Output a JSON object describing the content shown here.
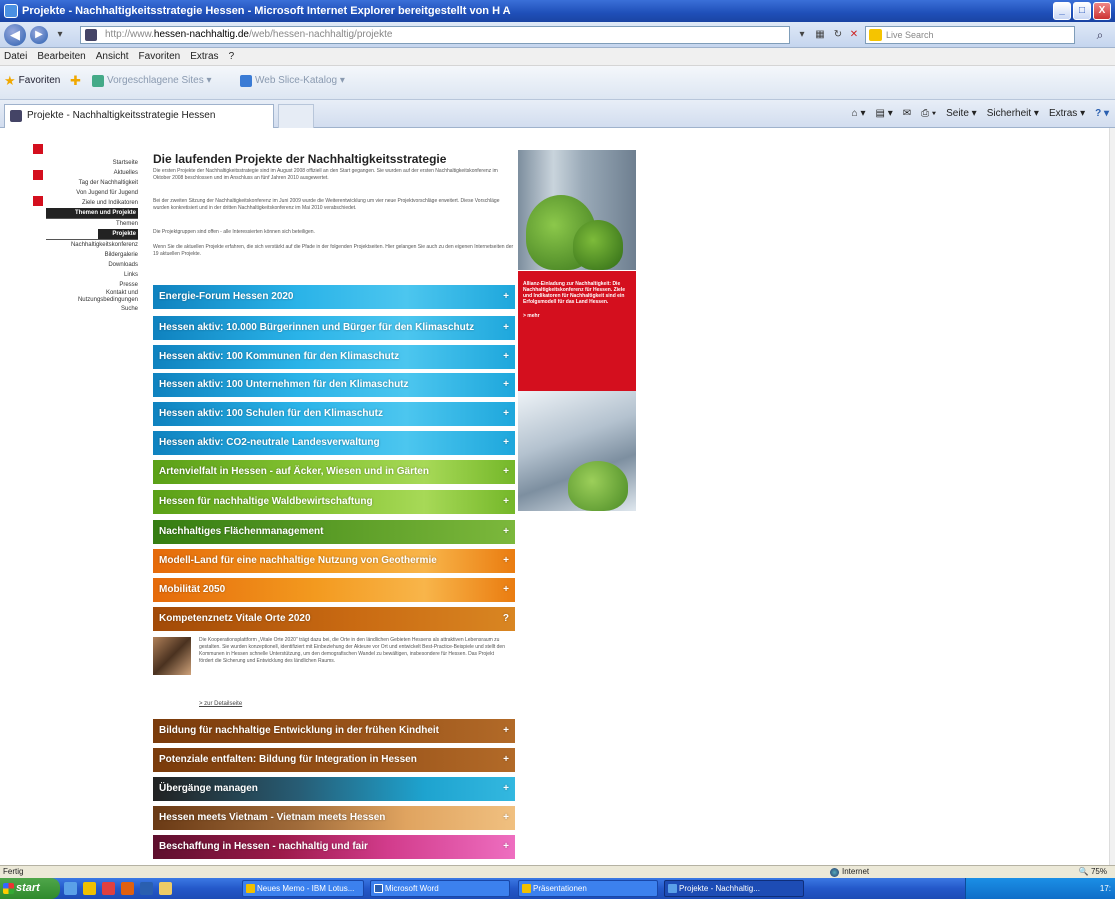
{
  "window": {
    "title": "Projekte - Nachhaltigkeitsstrategie Hessen - Microsoft Internet Explorer bereitgestellt von H A",
    "minimize": "_",
    "maximize": "□",
    "close": "X"
  },
  "address": {
    "url_prefix": "http://www.",
    "url_domain": "hessen-nachhaltig.de",
    "url_path": "/web/hessen-nachhaltig/projekte",
    "search_placeholder": "Live Search"
  },
  "menu": [
    "Datei",
    "Bearbeiten",
    "Ansicht",
    "Favoriten",
    "Extras",
    "?"
  ],
  "favbar": {
    "favorites": "Favoriten",
    "item1": "Vorgeschlagene Sites ▾",
    "item2": "Web Slice-Katalog ▾"
  },
  "tab": {
    "label": "Projekte - Nachhaltigkeitsstrategie Hessen"
  },
  "commandbar": [
    "Seite ▾",
    "Sicherheit ▾",
    "Extras ▾"
  ],
  "sidebar": {
    "items": [
      {
        "label": "Startseite"
      },
      {
        "label": "Aktuelles"
      },
      {
        "label": "Tag der Nachhaltigkeit"
      },
      {
        "label": "Von Jugend für Jugend"
      },
      {
        "label": "Ziele und Indikatoren"
      },
      {
        "label": "Themen und Projekte"
      },
      {
        "label": "Themen"
      },
      {
        "label": "Projekte"
      },
      {
        "label": "Nachhaltigkeitskonferenz"
      },
      {
        "label": "Bildergalerie"
      },
      {
        "label": "Downloads"
      },
      {
        "label": "Links"
      },
      {
        "label": "Presse"
      },
      {
        "label": "Kontakt und Nutzungsbedingungen"
      },
      {
        "label": "Suche"
      }
    ]
  },
  "main": {
    "title": "Die laufenden Projekte der Nachhaltigkeitsstrategie",
    "para1": "Die ersten Projekte der Nachhaltigkeitsstrategie sind im August 2008 offiziell an den Start gegangen. Sie wurden auf der ersten Nachhaltigkeitskonferenz im Oktober 2008 beschlossen und im Anschluss an fünf Jahren 2010 ausgewertet.",
    "para2": "Bei der zweiten Sitzung der Nachhaltigkeitskonferenz im Juni 2009 wurde die Weiterentwicklung um vier neue Projektvorschläge erweitert. Diese Vorschläge wurden konkretisiert und in der dritten Nachhaltigkeitskonferenz im Mai 2010 verabschiedet.",
    "para3": "Die Projektgruppen sind offen - alle Interessierten können sich beteiligen.",
    "para4": "Wenn Sie die aktuellen Projekte erfahren, die sich verstärkt auf die Pfade in der folgenden Projektseiten. Hier gelangen Sie auch zu den eigenen Internetseiten der 19 aktuellen Projekte.",
    "projects": [
      {
        "label": "Energie-Forum Hessen 2020",
        "sign": "+"
      },
      {
        "label": "Hessen aktiv: 10.000 Bürgerinnen und Bürger für den Klimaschutz",
        "sign": "+"
      },
      {
        "label": "Hessen aktiv: 100 Kommunen für den Klimaschutz",
        "sign": "+"
      },
      {
        "label": "Hessen aktiv: 100 Unternehmen für den Klimaschutz",
        "sign": "+"
      },
      {
        "label": "Hessen aktiv: 100 Schulen für den Klimaschutz",
        "sign": "+"
      },
      {
        "label": "Hessen aktiv: CO2-neutrale Landesverwaltung",
        "sign": "+"
      },
      {
        "label": "Artenvielfalt in Hessen - auf Äcker, Wiesen und in Gärten",
        "sign": "+"
      },
      {
        "label": "Hessen für nachhaltige Waldbewirtschaftung",
        "sign": "+"
      },
      {
        "label": "Nachhaltiges Flächenmanagement",
        "sign": "+"
      },
      {
        "label": "Modell-Land für eine nachhaltige Nutzung von Geothermie",
        "sign": "+"
      },
      {
        "label": "Mobilität 2050",
        "sign": "+"
      },
      {
        "label": "Kompetenznetz Vitale Orte 2020",
        "sign": "?"
      },
      {
        "label": "Bildung für nachhaltige Entwicklung in der frühen Kindheit",
        "sign": "+"
      },
      {
        "label": "Potenziale entfalten: Bildung für Integration in Hessen",
        "sign": "+"
      },
      {
        "label": "Übergänge managen",
        "sign": "+"
      },
      {
        "label": "Hessen meets Vietnam - Vietnam meets Hessen",
        "sign": "+"
      },
      {
        "label": "Beschaffung in Hessen - nachhaltig und fair",
        "sign": "+"
      }
    ],
    "detail_text": "Die Kooperationsplattform „Vitale Orte 2020\" trägt dazu bei, die Orte in den ländlichen Gebieten Hessens als attraktiven Lebensraum zu gestalten. Sie wurden konzeptionell, identifiziert mit Einbeziehung der Akteure vor Ort und entwickelt Best-Practice-Beispiele und stellt den Kommunen in Hessen schnelle Unterstützung, um den demografischen Wandel zu bewältigen, insbesondere für Hessen. Das Projekt fördert die Sicherung und Entwicklung des ländlichen Raums.",
    "detail_more": "> zur Detailseite"
  },
  "promo": {
    "text": "Allianz-Einladung zur Nachhaltigkeit: Die Nachhaltigkeitskonferenz für Hessen. Ziele und Indikatoren für Nachhaltigkeit sind ein Erfolgsmodell für das Land Hessen.",
    "link": "> mehr"
  },
  "status": {
    "left": "Fertig",
    "zone": "Internet",
    "zoom": "75%"
  },
  "taskbar": {
    "start": "start",
    "buttons": [
      {
        "label": "Neues Memo - IBM Lotus..."
      },
      {
        "label": "Microsoft Word"
      },
      {
        "label": "Präsentationen"
      },
      {
        "label": "Projekte - Nachhaltig..."
      }
    ],
    "clock": "17:"
  },
  "colors": {
    "accent_red": "#d40f1e",
    "ie_blue": "#1f4fb8"
  }
}
